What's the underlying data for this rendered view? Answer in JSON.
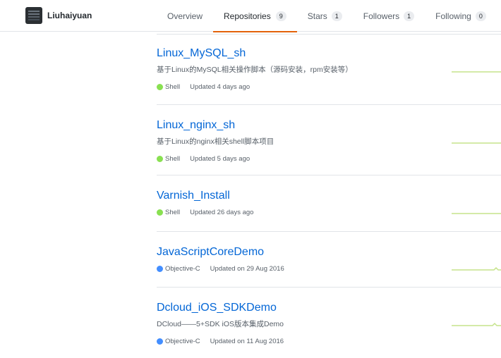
{
  "profile": {
    "username": "Liuhaiyuan"
  },
  "tabs": [
    {
      "label": "Overview",
      "count": null,
      "selected": false
    },
    {
      "label": "Repositories",
      "count": "9",
      "selected": true
    },
    {
      "label": "Stars",
      "count": "1",
      "selected": false
    },
    {
      "label": "Followers",
      "count": "1",
      "selected": false
    },
    {
      "label": "Following",
      "count": "0",
      "selected": false
    }
  ],
  "repos": [
    {
      "name": "Linux_MySQL_sh",
      "description": "基于Linux的MySQL相关操作脚本（源码安装，rpm安装等）",
      "language": "Shell",
      "language_color": "#89e051",
      "updated": "Updated 4 days ago"
    },
    {
      "name": "Linux_nginx_sh",
      "description": "基于Linux的nginx相关shell脚本项目",
      "language": "Shell",
      "language_color": "#89e051",
      "updated": "Updated 5 days ago"
    },
    {
      "name": "Varnish_Install",
      "description": "",
      "language": "Shell",
      "language_color": "#89e051",
      "updated": "Updated 26 days ago"
    },
    {
      "name": "JavaScriptCoreDemo",
      "description": "",
      "language": "Objective-C",
      "language_color": "#438eff",
      "updated": "Updated on 29 Aug 2016"
    },
    {
      "name": "Dcloud_iOS_SDKDemo",
      "description": "DCloud——5+SDK iOS版本集成Demo",
      "language": "Objective-C",
      "language_color": "#438eff",
      "updated": "Updated on 11 Aug 2016"
    }
  ],
  "colors": {
    "accent": "#e36209",
    "link": "#0366d6",
    "sparkline": "#c6e48b"
  }
}
